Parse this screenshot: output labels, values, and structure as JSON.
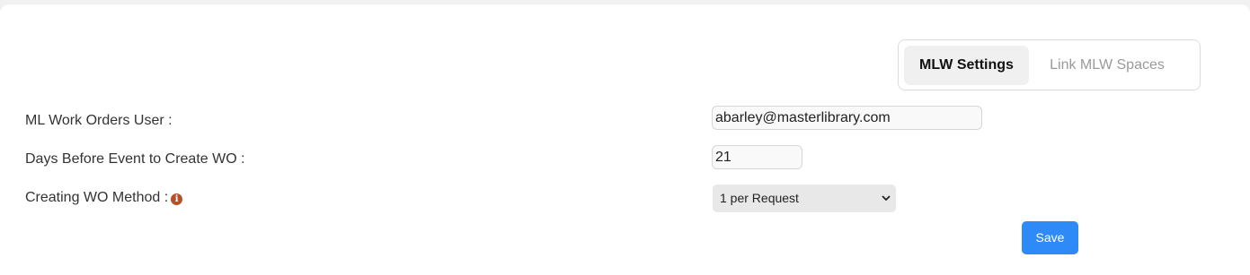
{
  "tabs": {
    "active_label": "MLW Settings",
    "other_label": "Link MLW Spaces"
  },
  "form": {
    "user_label": "ML Work Orders User :",
    "user_value": "abarley@masterlibrary.com",
    "days_label": "Days Before Event to Create WO :",
    "days_value": "21",
    "method_label": "Creating WO Method :",
    "method_value": "1 per Request"
  },
  "actions": {
    "save_label": "Save"
  },
  "colors": {
    "primary_button": "#2e8af7",
    "info_icon": "#b4502a"
  },
  "icons": {
    "info": "info-circle-icon",
    "dropdown": "chevron-down-icon"
  }
}
